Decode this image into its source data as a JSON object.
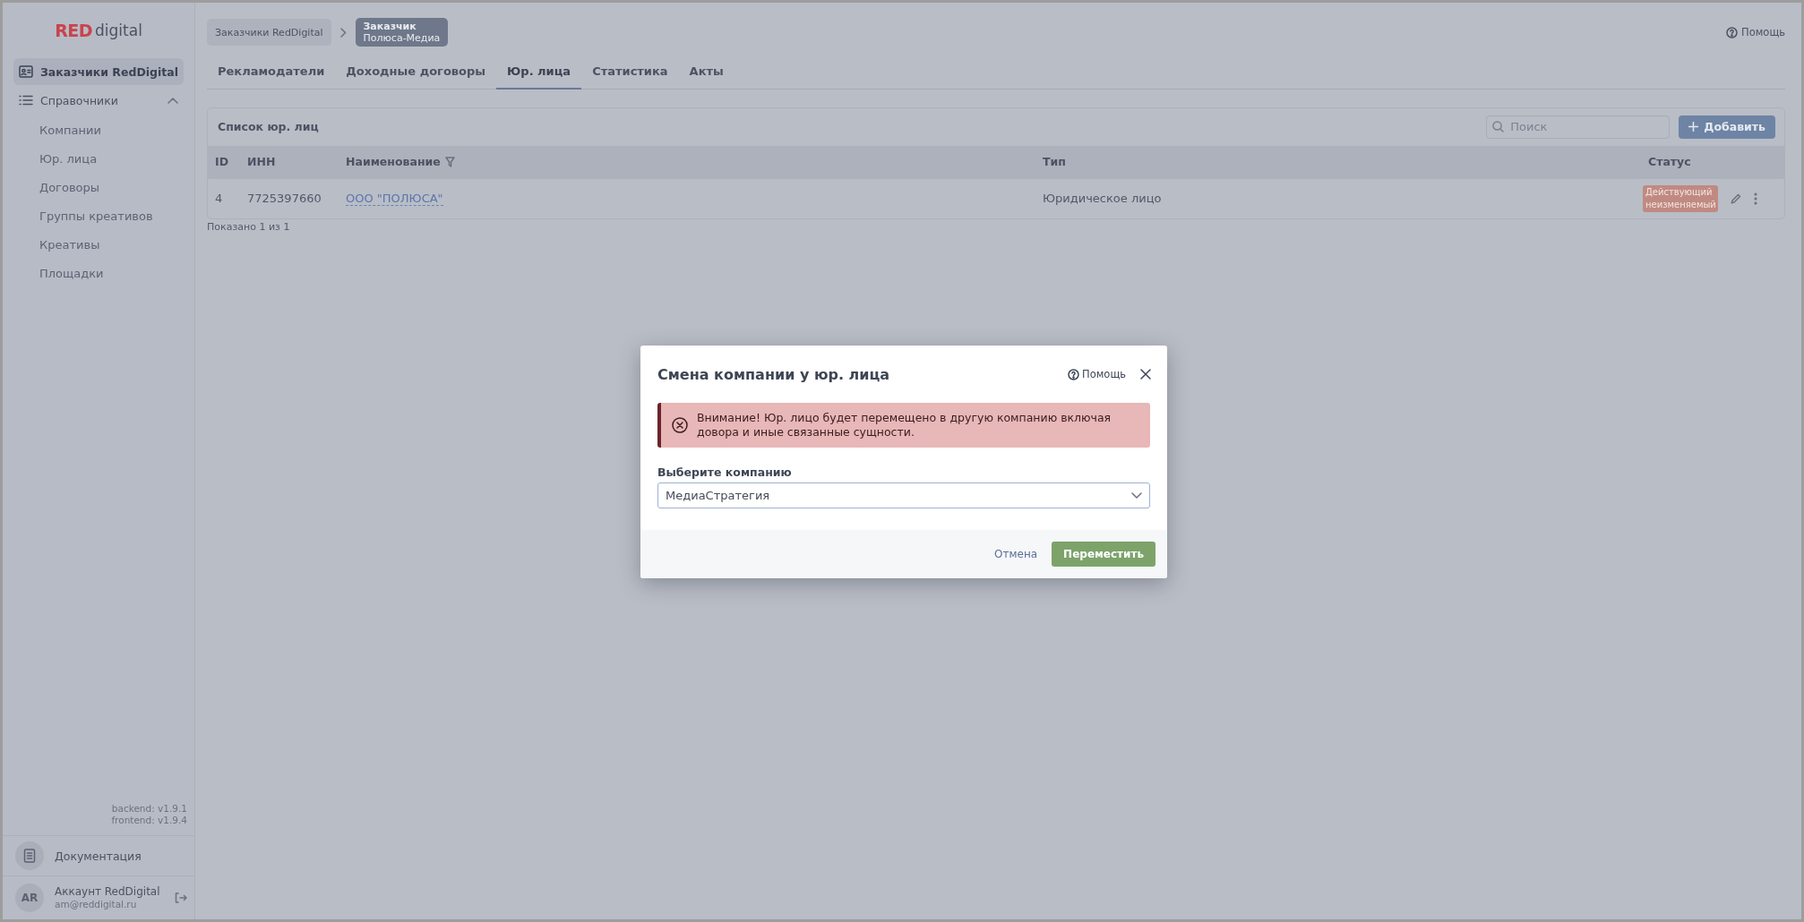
{
  "logo": {
    "brand": "RED",
    "suffix": "digital"
  },
  "sidebar": {
    "items": [
      {
        "label": "Заказчики RedDigital",
        "kind": "link",
        "selected": true
      },
      {
        "label": "Справочники",
        "kind": "group",
        "expanded": true,
        "children": [
          {
            "label": "Компании",
            "selected": false
          },
          {
            "label": "Юр. лица",
            "selected": false
          },
          {
            "label": "Договоры",
            "selected": false
          },
          {
            "label": "Группы креативов",
            "selected": false
          },
          {
            "label": "Креативы",
            "selected": false
          },
          {
            "label": "Площадки",
            "selected": false
          }
        ]
      }
    ],
    "versions": [
      "backend: v1.9.1",
      "frontend: v1.9.4"
    ],
    "docs": "Документация",
    "account": {
      "initials": "AR",
      "name": "Аккаунт RedDigital",
      "email": "am@reddigital.ru"
    }
  },
  "header": {
    "breadcrumbs": [
      {
        "title": "Заказчики RedDigital",
        "selected": false
      },
      {
        "title": "Заказчик",
        "subtitle": "Полюса-Медиа",
        "selected": true
      }
    ],
    "help": "Помощь"
  },
  "tabs": [
    {
      "label": "Рекламодатели",
      "selected": false
    },
    {
      "label": "Доходные договоры",
      "selected": false
    },
    {
      "label": "Юр. лица",
      "selected": true
    },
    {
      "label": "Статистика",
      "selected": false
    },
    {
      "label": "Акты",
      "selected": false
    }
  ],
  "table": {
    "title": "Список юр. лиц",
    "search": {
      "placeholder": "Поиск"
    },
    "add_button": "Добавить",
    "columns": [
      {
        "label": "ID",
        "filter": false
      },
      {
        "label": "ИНН",
        "filter": false
      },
      {
        "label": "Наименование",
        "filter": true
      },
      {
        "label": "Тип",
        "filter": false
      },
      {
        "label": "Статус",
        "filter": false
      }
    ],
    "rows": [
      {
        "id": "4",
        "inn": "7725397660",
        "name": "ООО \"ПОЛЮСА\"",
        "type": "Юридическое лицо",
        "status": "Действующий неизменяемый"
      }
    ],
    "footer": "Показано 1 из 1"
  },
  "dialog": {
    "title": "Смена компании у юр. лица",
    "help": "Помощь",
    "alert": "Внимание! Юр. лицо будет перемещено в другую компанию включая довора и иные связанные сущности.",
    "field_label": "Выберите компанию",
    "field_value": "МедиаСтратегия",
    "cancel": "Отмена",
    "confirm": "Переместить"
  }
}
